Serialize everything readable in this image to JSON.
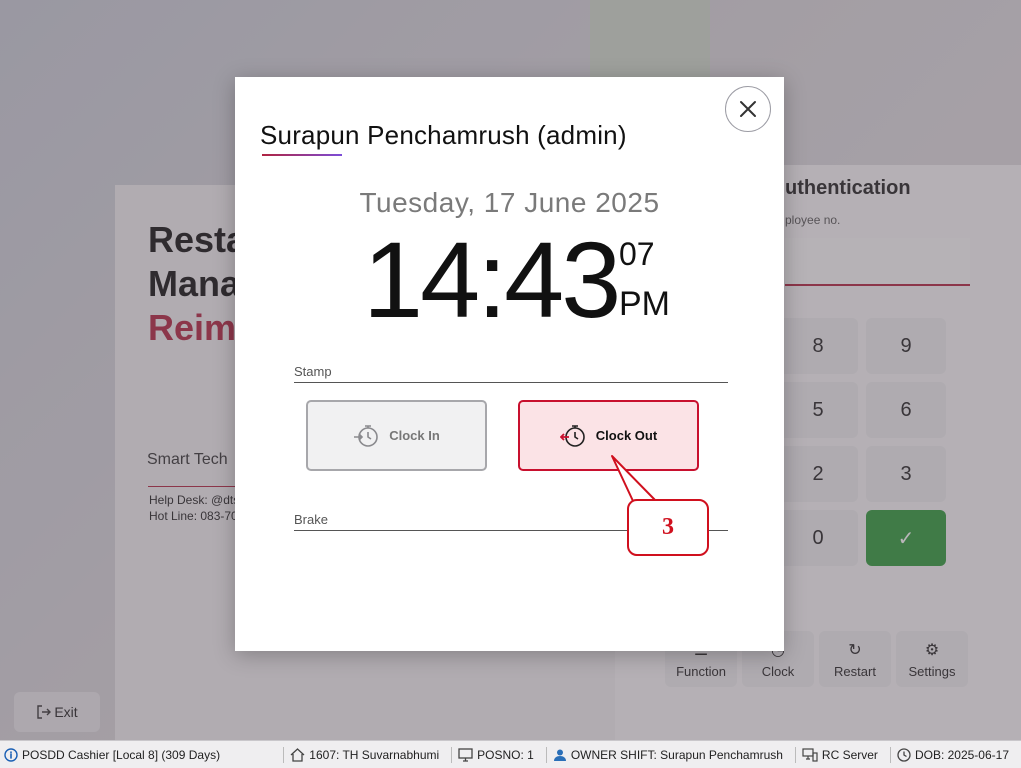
{
  "background": {
    "title_lines": [
      "Resta",
      "Mana"
    ],
    "title_red": "Reim",
    "smart_text": "Smart Tech",
    "help_desk": "Help Desk: @dts",
    "hot_line": "Hot Line: 083-70",
    "auth_title": "uthentication",
    "auth_sub": "ployee no.",
    "keys": [
      "8",
      "9",
      "5",
      "6",
      "2",
      "3",
      "0"
    ],
    "function_buttons": [
      "Function",
      "Clock",
      "Restart",
      "Settings"
    ],
    "exit_label": "Exit"
  },
  "modal": {
    "user_name": "Surapun Penchamrush (admin)",
    "date": "Tuesday, 17 June 2025",
    "time": "14:43",
    "seconds": "07",
    "ampm": "PM",
    "stamp_label": "Stamp",
    "clock_in_label": "Clock In",
    "clock_out_label": "Clock Out",
    "brake_label": "Brake"
  },
  "annotation": {
    "step": "3"
  },
  "status_bar": {
    "app": "POSDD Cashier [Local 8] (309 Days)",
    "branch": "1607: TH Suvarnabhumi",
    "posno": "POSNO: 1",
    "owner_shift": "OWNER SHIFT: Surapun Penchamrush",
    "server": "RC Server",
    "dob": "DOB: 2025-06-17"
  },
  "colors": {
    "accent_red": "#c8102e",
    "ok_green": "#2e9a3a"
  }
}
